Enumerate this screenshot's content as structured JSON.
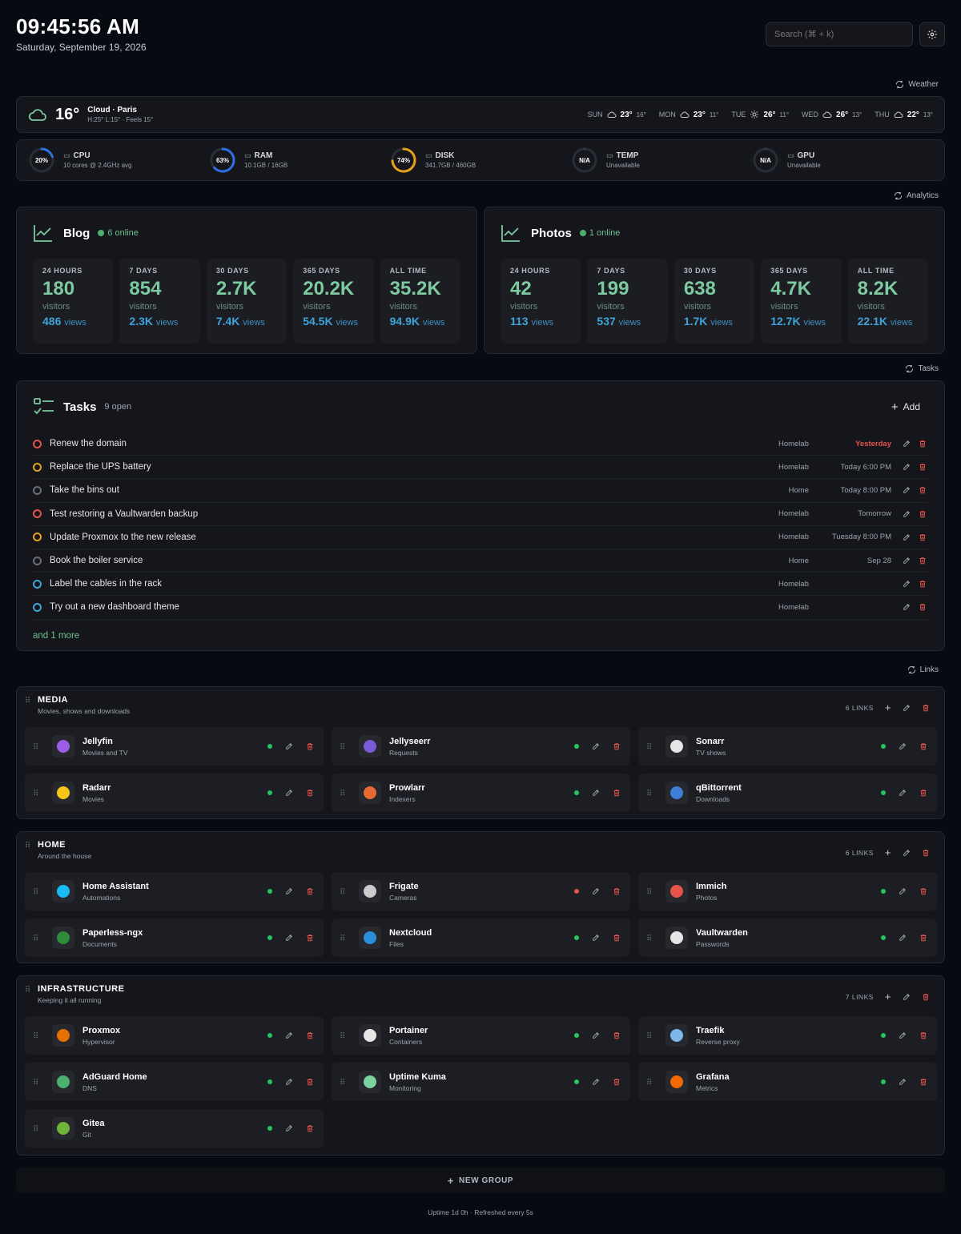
{
  "header": {
    "time": "09:45:56 AM",
    "date": "Saturday, September 19, 2026",
    "search_placeholder": "Search (⌘ + k)"
  },
  "sections": {
    "weather": "Weather",
    "analytics": "Analytics",
    "tasks": "Tasks",
    "links": "Links"
  },
  "weather": {
    "temp": "16°",
    "location": "Cloud · Paris",
    "details": "H:25° L:15° · Feels 15°",
    "forecast": [
      {
        "day": "SUN",
        "icon": "cloud-icon",
        "hi": "23°",
        "lo": "16°"
      },
      {
        "day": "MON",
        "icon": "cloud-icon",
        "hi": "23°",
        "lo": "11°"
      },
      {
        "day": "TUE",
        "icon": "sun-icon",
        "hi": "26°",
        "lo": "11°"
      },
      {
        "day": "WED",
        "icon": "cloud-icon",
        "hi": "26°",
        "lo": "13°"
      },
      {
        "day": "THU",
        "icon": "cloud-icon",
        "hi": "22°",
        "lo": "13°"
      }
    ]
  },
  "system": [
    {
      "label": "CPU",
      "sub": "10 cores @ 2.4GHz avg",
      "value": "20%",
      "fraction": 0.2,
      "color": "#2f6fe4",
      "icon": "cpu-icon"
    },
    {
      "label": "RAM",
      "sub": "10.1GB / 16GB",
      "value": "63%",
      "fraction": 0.63,
      "color": "#2f6fe4",
      "icon": "ram-icon"
    },
    {
      "label": "DISK",
      "sub": "341.7GB / 460GB",
      "value": "74%",
      "fraction": 0.74,
      "color": "#e3a21a",
      "icon": "disk-icon"
    },
    {
      "label": "TEMP",
      "sub": "Unavailable",
      "value": "N/A",
      "fraction": 0,
      "color": "#3a3d45",
      "icon": "thermometer-icon"
    },
    {
      "label": "GPU",
      "sub": "Unavailable",
      "value": "N/A",
      "fraction": 0,
      "color": "#3a3d45",
      "icon": "gauge-icon"
    }
  ],
  "analytics": [
    {
      "name": "Blog",
      "online": "6 online",
      "tiles": [
        {
          "period": "24 HOURS",
          "visitors": "180",
          "views": "486"
        },
        {
          "period": "7 DAYS",
          "visitors": "854",
          "views": "2.3K"
        },
        {
          "period": "30 DAYS",
          "visitors": "2.7K",
          "views": "7.4K"
        },
        {
          "period": "365 DAYS",
          "visitors": "20.2K",
          "views": "54.5K"
        },
        {
          "period": "ALL TIME",
          "visitors": "35.2K",
          "views": "94.9K"
        }
      ]
    },
    {
      "name": "Photos",
      "online": "1 online",
      "tiles": [
        {
          "period": "24 HOURS",
          "visitors": "42",
          "views": "113"
        },
        {
          "period": "7 DAYS",
          "visitors": "199",
          "views": "537"
        },
        {
          "period": "30 DAYS",
          "visitors": "638",
          "views": "1.7K"
        },
        {
          "period": "365 DAYS",
          "visitors": "4.7K",
          "views": "12.7K"
        },
        {
          "period": "ALL TIME",
          "visitors": "8.2K",
          "views": "22.1K"
        }
      ]
    }
  ],
  "analytics_labels": {
    "visitors": "visitors",
    "views": "views"
  },
  "tasks": {
    "title": "Tasks",
    "count": "9 open",
    "add": "Add",
    "more": "and 1 more",
    "items": [
      {
        "title": "Renew the domain",
        "category": "Homelab",
        "due": "Yesterday",
        "priority_color": "#e5534b",
        "overdue": true
      },
      {
        "title": "Replace the UPS battery",
        "category": "Homelab",
        "due": "Today 6:00 PM",
        "priority_color": "#e3a21a"
      },
      {
        "title": "Take the bins out",
        "category": "Home",
        "due": "Today 8:00 PM",
        "priority_color": "#6b6e76"
      },
      {
        "title": "Test restoring a Vaultwarden backup",
        "category": "Homelab",
        "due": "Tomorrow",
        "priority_color": "#e5534b"
      },
      {
        "title": "Update Proxmox to the new release",
        "category": "Homelab",
        "due": "Tuesday 8:00 PM",
        "priority_color": "#e3a21a"
      },
      {
        "title": "Book the boiler service",
        "category": "Home",
        "due": "Sep 28",
        "priority_color": "#6b6e76"
      },
      {
        "title": "Label the cables in the rack",
        "category": "Homelab",
        "due": "",
        "priority_color": "#3ea3d9"
      },
      {
        "title": "Try out a new dashboard theme",
        "category": "Homelab",
        "due": "",
        "priority_color": "#3ea3d9"
      }
    ]
  },
  "groups": [
    {
      "title": "MEDIA",
      "subtitle": "Movies, shows and downloads",
      "count": "6 LINKS",
      "links": [
        {
          "name": "Jellyfin",
          "sub": "Movies and TV",
          "status": "#22c55e",
          "icon": "jellyfin-icon",
          "color": "#9b5de5"
        },
        {
          "name": "Jellyseerr",
          "sub": "Requests",
          "status": "#22c55e",
          "icon": "jellyseerr-icon",
          "color": "#7b5cd6"
        },
        {
          "name": "Sonarr",
          "sub": "TV shows",
          "status": "#22c55e",
          "icon": "sonarr-icon",
          "color": "#e6e6e6"
        },
        {
          "name": "Radarr",
          "sub": "Movies",
          "status": "#22c55e",
          "icon": "radarr-icon",
          "color": "#f5c518"
        },
        {
          "name": "Prowlarr",
          "sub": "Indexers",
          "status": "#22c55e",
          "icon": "prowlarr-icon",
          "color": "#e86a33"
        },
        {
          "name": "qBittorrent",
          "sub": "Downloads",
          "status": "#22c55e",
          "icon": "qbittorrent-icon",
          "color": "#3d7fd6"
        }
      ]
    },
    {
      "title": "HOME",
      "subtitle": "Around the house",
      "count": "6 LINKS",
      "links": [
        {
          "name": "Home Assistant",
          "sub": "Automations",
          "status": "#22c55e",
          "icon": "home-assistant-icon",
          "color": "#18bcf2"
        },
        {
          "name": "Frigate",
          "sub": "Cameras",
          "status": "#e5534b",
          "icon": "frigate-icon",
          "color": "#cccccc"
        },
        {
          "name": "Immich",
          "sub": "Photos",
          "status": "#22c55e",
          "icon": "immich-icon",
          "color": "#e5534b"
        },
        {
          "name": "Paperless-ngx",
          "sub": "Documents",
          "status": "#22c55e",
          "icon": "paperless-icon",
          "color": "#2e8b3a"
        },
        {
          "name": "Nextcloud",
          "sub": "Files",
          "status": "#22c55e",
          "icon": "nextcloud-icon",
          "color": "#2a8fd8"
        },
        {
          "name": "Vaultwarden",
          "sub": "Passwords",
          "status": "#22c55e",
          "icon": "vaultwarden-icon",
          "color": "#e6e6e6"
        }
      ]
    },
    {
      "title": "INFRASTRUCTURE",
      "subtitle": "Keeping it all running",
      "count": "7 LINKS",
      "links": [
        {
          "name": "Proxmox",
          "sub": "Hypervisor",
          "status": "#22c55e",
          "icon": "proxmox-icon",
          "color": "#e57000"
        },
        {
          "name": "Portainer",
          "sub": "Containers",
          "status": "#22c55e",
          "icon": "portainer-icon",
          "color": "#e6e6e6"
        },
        {
          "name": "Traefik",
          "sub": "Reverse proxy",
          "status": "#22c55e",
          "icon": "traefik-icon",
          "color": "#7db6e8"
        },
        {
          "name": "AdGuard Home",
          "sub": "DNS",
          "status": "#22c55e",
          "icon": "adguard-icon",
          "color": "#4caf6e"
        },
        {
          "name": "Uptime Kuma",
          "sub": "Monitoring",
          "status": "#22c55e",
          "icon": "uptime-kuma-icon",
          "color": "#7dd3a0"
        },
        {
          "name": "Grafana",
          "sub": "Metrics",
          "status": "#22c55e",
          "icon": "grafana-icon",
          "color": "#f46800"
        },
        {
          "name": "Gitea",
          "sub": "Git",
          "status": "#22c55e",
          "icon": "gitea-icon",
          "color": "#6fb33a"
        }
      ]
    }
  ],
  "new_group": "NEW GROUP",
  "footer": "Uptime 1d 0h · Refreshed every 5s"
}
